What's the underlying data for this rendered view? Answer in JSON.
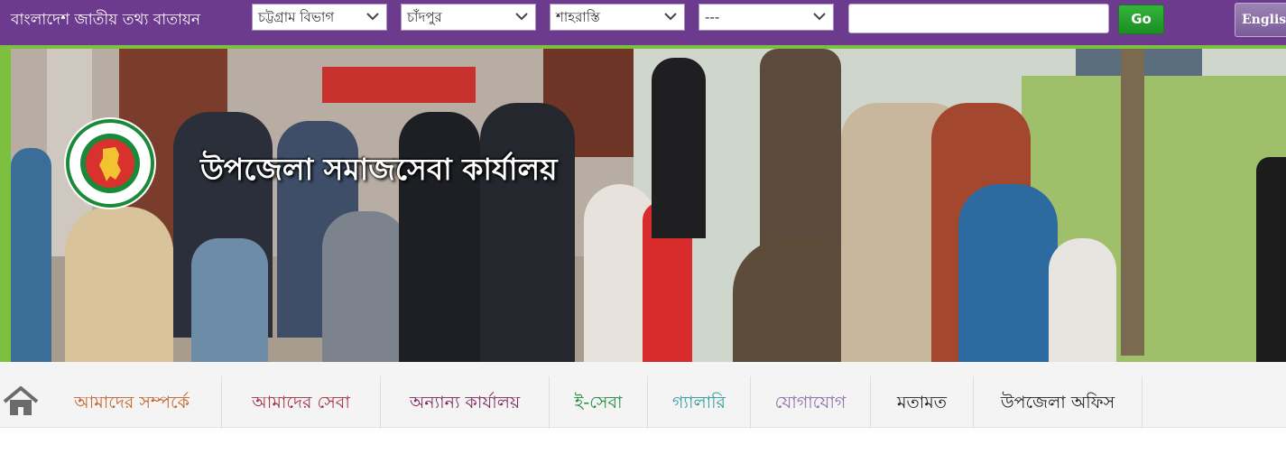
{
  "topbar": {
    "portal_title": "বাংলাদেশ জাতীয় তথ্য বাতায়ন",
    "division_select": "চট্টগ্রাম বিভাগ",
    "district_select": "চাঁদপুর",
    "upazila_select": "শাহরাস্তি",
    "union_select": "---",
    "search_value": "",
    "go_label": "Go",
    "language_label": "English",
    "colors": {
      "background": "#6c3b8e",
      "go_button": "#22a02b"
    }
  },
  "banner": {
    "office_name": "উপজেলা সমাজসেবা কার্যালয়"
  },
  "nav": {
    "home_icon": "home-icon",
    "items": [
      {
        "label": "আমাদের সম্পর্কে",
        "color": "#c0632a"
      },
      {
        "label": "আমাদের সেবা",
        "color": "#9c2f44"
      },
      {
        "label": "অন্যান্য কার্যালয়",
        "color": "#7a2a5e"
      },
      {
        "label": "ই-সেবা",
        "color": "#1f8a3a"
      },
      {
        "label": "গ্যালারি",
        "color": "#2a9a9a"
      },
      {
        "label": "যোগাযোগ",
        "color": "#8a6aa8"
      },
      {
        "label": "মতামত",
        "color": "#222222"
      },
      {
        "label": "উপজেলা অফিস",
        "color": "#222222"
      }
    ]
  }
}
